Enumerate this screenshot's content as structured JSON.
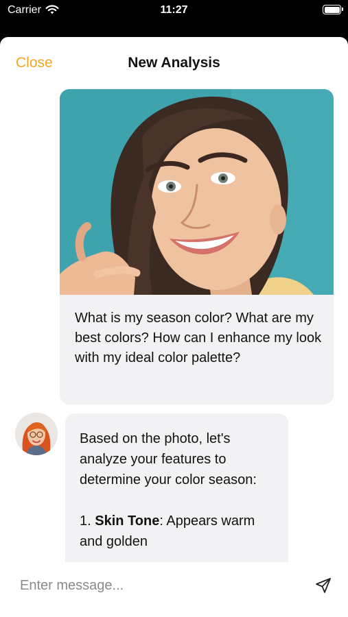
{
  "status_bar": {
    "carrier": "Carrier",
    "time": "11:27"
  },
  "nav": {
    "close_label": "Close",
    "title": "New Analysis"
  },
  "user_message": {
    "text": "What is my season color? What are my best colors? How can I enhance my look with my ideal color palette?"
  },
  "bot_message": {
    "para1": "Based on the photo, let's analyze your features to determine your color season:",
    "item1_number": "1.",
    "item1_label": "Skin Tone",
    "item1_text": ": Appears warm and golden"
  },
  "input": {
    "placeholder": "Enter message..."
  },
  "colors": {
    "accent": "#f5a623",
    "bubble": "#f2f2f4",
    "photo_background": "#3fa3ad"
  },
  "icons": {
    "wifi": "wifi-icon",
    "battery": "battery-icon",
    "send": "send-icon"
  }
}
